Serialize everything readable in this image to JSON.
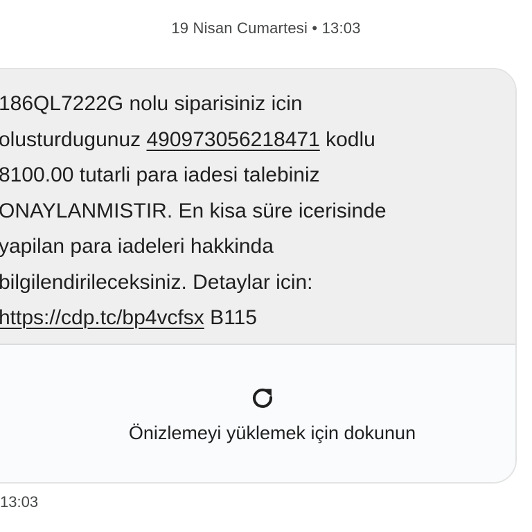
{
  "header": {
    "date_label": "19 Nisan Cumartesi • 13:03"
  },
  "message": {
    "lines": [
      {
        "pre": "186QL7222G nolu siparisiniz icin",
        "link": "",
        "post": ""
      },
      {
        "pre": "olusturdugunuz ",
        "link": "490973056218471",
        "post": " kodlu"
      },
      {
        "pre": "8100.00 tutarli para iadesi talebiniz",
        "link": "",
        "post": ""
      },
      {
        "pre": "ONAYLANMISTIR. En kisa süre icerisinde",
        "link": "",
        "post": ""
      },
      {
        "pre": "yapilan para iadeleri hakkinda",
        "link": "",
        "post": ""
      },
      {
        "pre": "bilgilendirileceksiniz. Detaylar icin:",
        "link": "",
        "post": ""
      },
      {
        "pre": "",
        "link": "https://cdp.tc/bp4vcfsx",
        "post": " B115"
      }
    ]
  },
  "preview": {
    "icon": "refresh-icon",
    "label": "Önizlemeyi yüklemek için dokunun"
  },
  "timestamp": "13:03",
  "colors": {
    "bubble_bg": "#efefef",
    "preview_bg": "#f9fbfd",
    "border": "#e3e3e3",
    "text": "#1f1f1f",
    "muted_text": "#444746"
  }
}
